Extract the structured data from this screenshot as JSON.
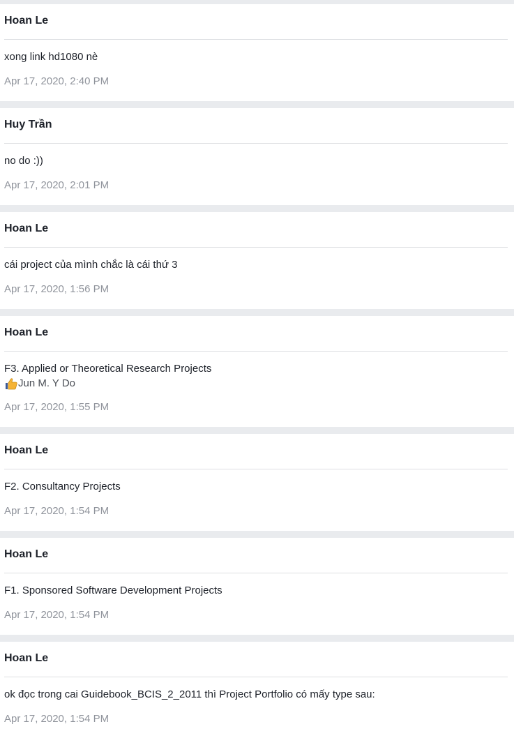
{
  "messages": [
    {
      "sender": "Hoan Le",
      "text": "xong link hd1080 nè",
      "timestamp": "Apr 17, 2020, 2:40 PM"
    },
    {
      "sender": "Huy Trần",
      "text": "no do :))",
      "timestamp": "Apr 17, 2020, 2:01 PM"
    },
    {
      "sender": "Hoan Le",
      "text": "cái project của mình chắc là cái thứ 3",
      "timestamp": "Apr 17, 2020, 1:56 PM"
    },
    {
      "sender": "Hoan Le",
      "text": "F3. Applied or Theoretical Research Projects",
      "reaction": {
        "icon": "thumbs-up-icon",
        "user": "Jun M. Y Do"
      },
      "timestamp": "Apr 17, 2020, 1:55 PM"
    },
    {
      "sender": "Hoan Le",
      "text": "F2. Consultancy Projects",
      "timestamp": "Apr 17, 2020, 1:54 PM"
    },
    {
      "sender": "Hoan Le",
      "text": "F1. Sponsored Software Development Projects",
      "timestamp": "Apr 17, 2020, 1:54 PM"
    },
    {
      "sender": "Hoan Le",
      "text": "ok đọc trong cai Guidebook_BCIS_2_2011 thì Project Portfolio có mấy type sau:",
      "timestamp": "Apr 17, 2020, 1:54 PM"
    }
  ],
  "colors": {
    "background": "#e9ebee",
    "card": "#ffffff",
    "timestamp": "#90949c",
    "reaction_text": "#4b4f56",
    "thumb": "#f5b335"
  }
}
